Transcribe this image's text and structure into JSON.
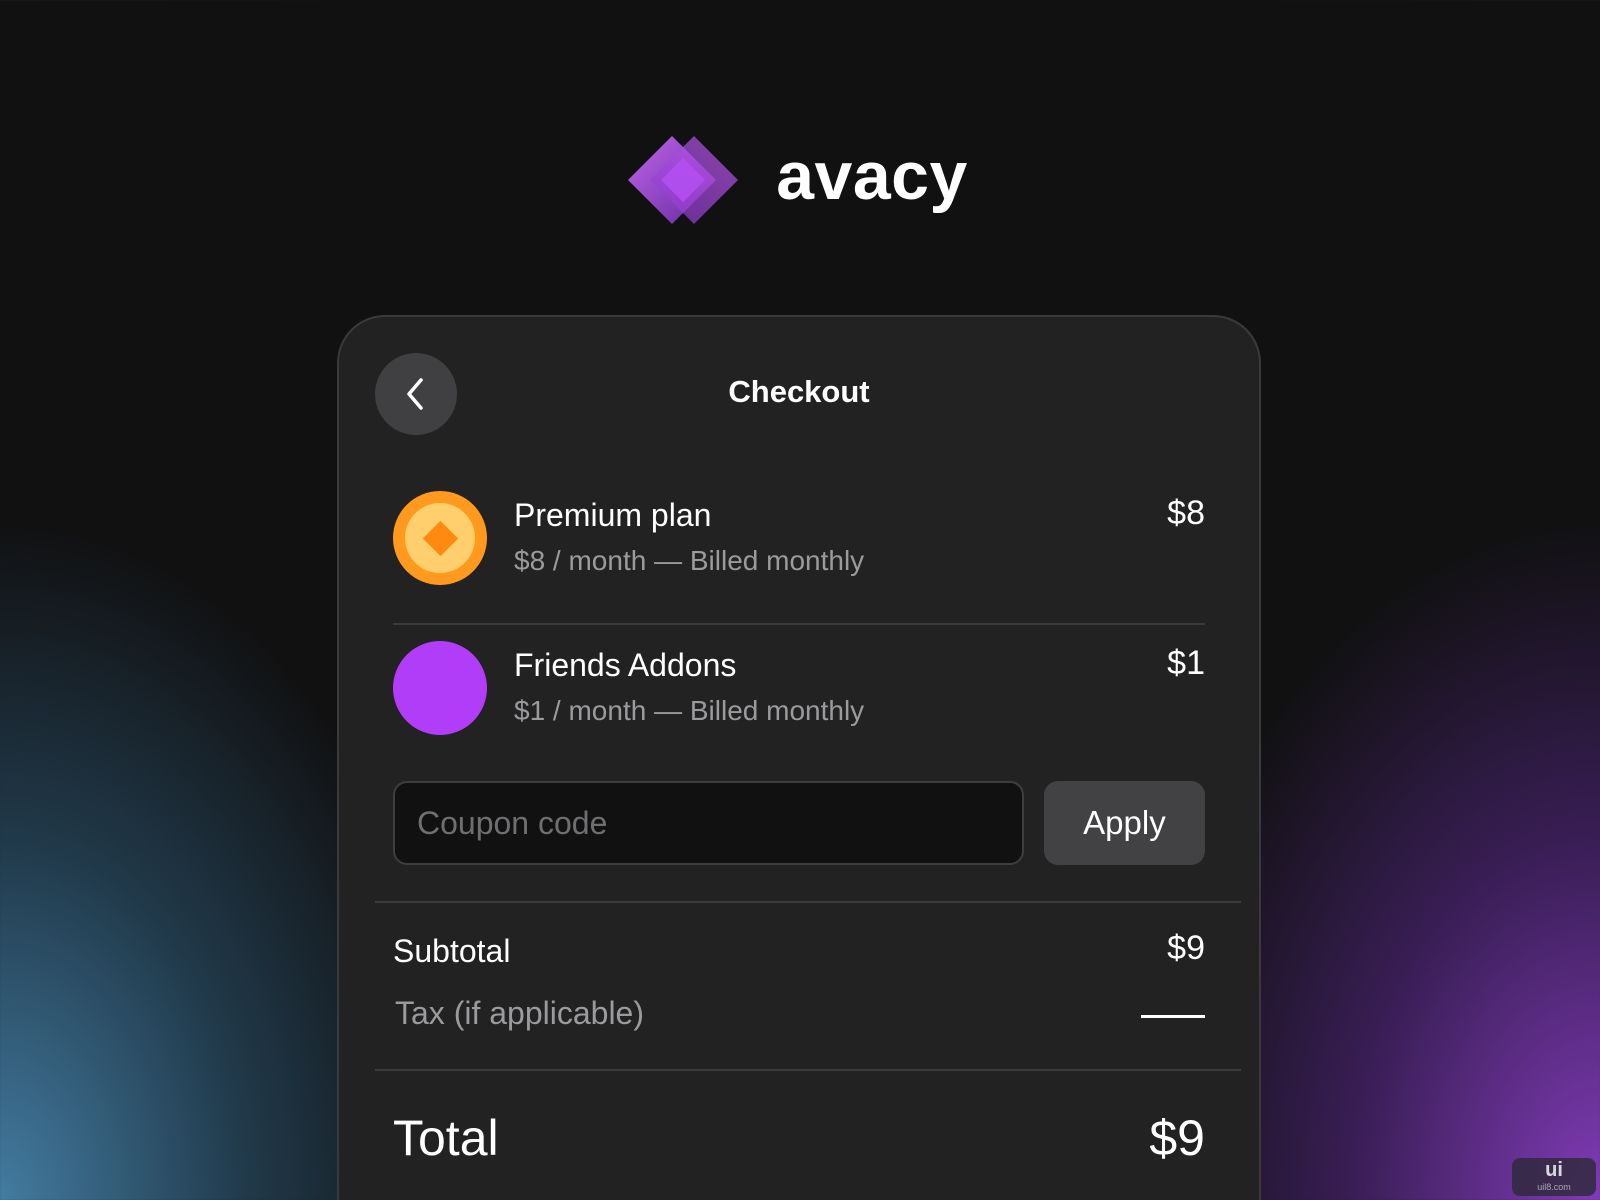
{
  "brand": {
    "name": "avacy",
    "icon": "avacy-diamond-logo",
    "colors": {
      "light": "#c15cf3",
      "dark": "#7a2fb5"
    }
  },
  "checkout": {
    "title": "Checkout",
    "back_icon": "chevron-left-icon",
    "items": [
      {
        "name": "Premium plan",
        "description": "$8 / month — Billed monthly",
        "price": "$8",
        "icon": "orange-diamond-coin-icon",
        "color": "#ff9a1f"
      },
      {
        "name": "Friends Addons",
        "description": "$1 / month — Billed monthly",
        "price": "$1",
        "icon": "purple-circle-icon",
        "color": "#b13df8"
      }
    ],
    "coupon": {
      "placeholder": "Coupon code",
      "value": "",
      "apply_label": "Apply"
    },
    "summary": {
      "subtotal_label": "Subtotal",
      "subtotal_value": "$9",
      "tax_label": "Tax (if applicable)",
      "tax_value": "—"
    },
    "total": {
      "label": "Total",
      "value": "$9"
    }
  },
  "watermark": {
    "main": "ui",
    "sub": "uil8.com"
  }
}
